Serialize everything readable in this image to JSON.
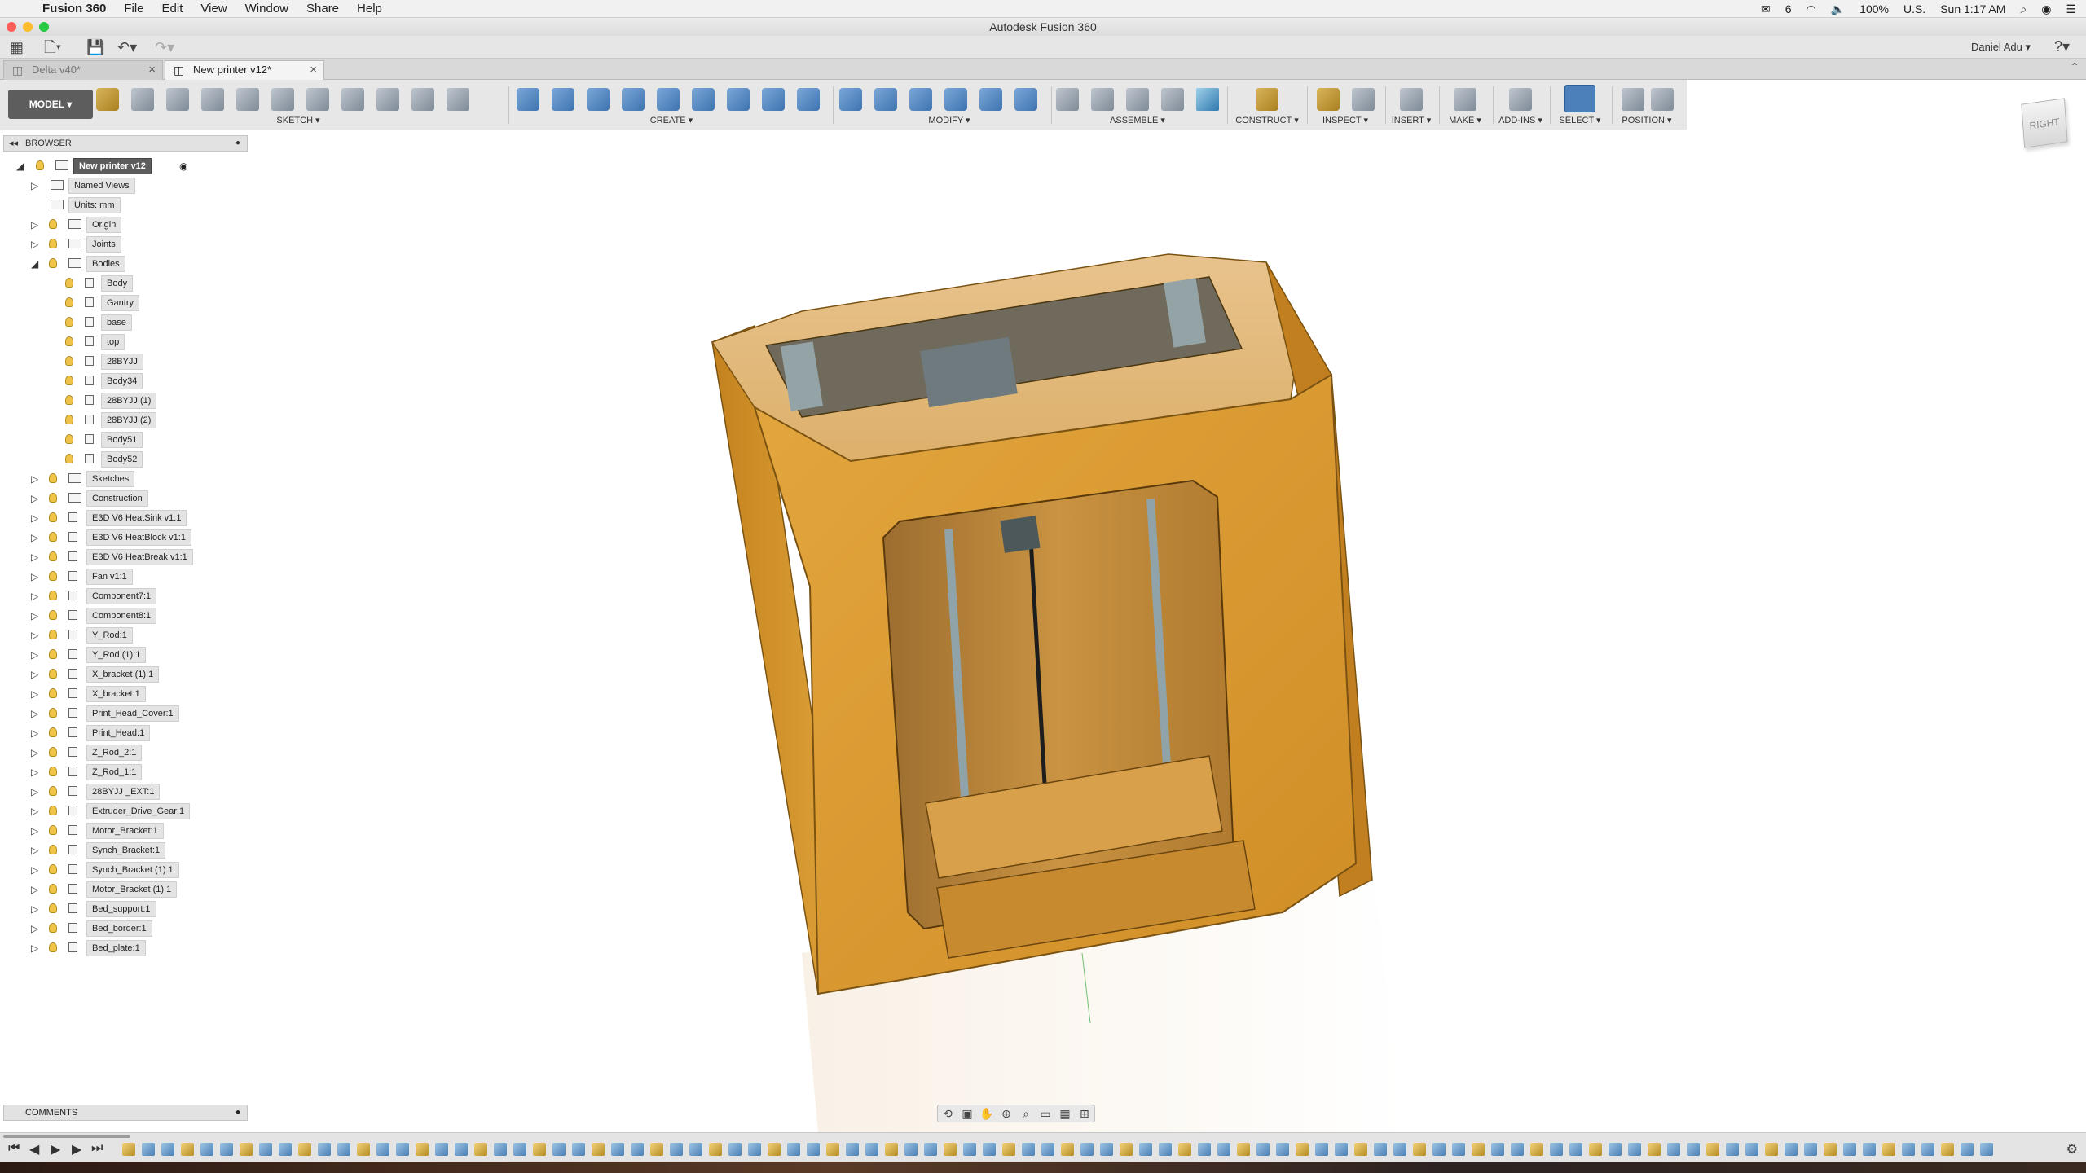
{
  "menubar": {
    "app_name": "Fusion 360",
    "items": [
      "File",
      "Edit",
      "View",
      "Window",
      "Share",
      "Help"
    ],
    "status": {
      "battery": "100%",
      "input_source": "U.S.",
      "clock": "Sun 1:17 AM",
      "notification_count": "6"
    }
  },
  "window": {
    "title": "Autodesk Fusion 360"
  },
  "quickbar": {
    "user": "Daniel Adu ▾"
  },
  "tabs": [
    {
      "label": "Delta v40*",
      "active": false
    },
    {
      "label": "New printer v12*",
      "active": true
    }
  ],
  "toolbar": {
    "mode": "MODEL ▾",
    "groups": [
      {
        "label": "SKETCH ▾"
      },
      {
        "label": "CREATE ▾"
      },
      {
        "label": "MODIFY ▾"
      },
      {
        "label": "ASSEMBLE ▾"
      },
      {
        "label": "CONSTRUCT ▾"
      },
      {
        "label": "INSPECT ▾"
      },
      {
        "label": "INSERT ▾"
      },
      {
        "label": "MAKE ▾"
      },
      {
        "label": "ADD-INS ▾"
      },
      {
        "label": "SELECT ▾"
      },
      {
        "label": "POSITION ▾"
      }
    ]
  },
  "viewcube": {
    "face": "RIGHT"
  },
  "browser": {
    "title": "BROWSER",
    "root": "New printer v12",
    "named_views": "Named Views",
    "units": "Units: mm",
    "folders_top": [
      "Origin",
      "Joints",
      "Bodies"
    ],
    "bodies": [
      "Body",
      "Gantry",
      "base",
      "top",
      "28BYJJ",
      "Body34",
      "28BYJJ (1)",
      "28BYJJ (2)",
      "Body51",
      "Body52"
    ],
    "components": [
      "Sketches",
      "Construction",
      "E3D V6 HeatSink v1:1",
      "E3D V6 HeatBlock v1:1",
      "E3D V6 HeatBreak v1:1",
      "Fan v1:1",
      "Component7:1",
      "Component8:1",
      "Y_Rod:1",
      "Y_Rod (1):1",
      "X_bracket (1):1",
      "X_bracket:1",
      "Print_Head_Cover:1",
      "Print_Head:1",
      "Z_Rod_2:1",
      "Z_Rod_1:1",
      "28BYJJ _EXT:1",
      "Extruder_Drive_Gear:1",
      "Motor_Bracket:1",
      "Synch_Bracket:1",
      "Synch_Bracket (1):1",
      "Motor_Bracket (1):1",
      "Bed_support:1",
      "Bed_border:1",
      "Bed_plate:1"
    ]
  },
  "comments": {
    "title": "COMMENTS"
  },
  "colors": {
    "model_orange": "#e0a23a",
    "model_dark": "#b77a1c",
    "accent_blue": "#4b80bb"
  }
}
